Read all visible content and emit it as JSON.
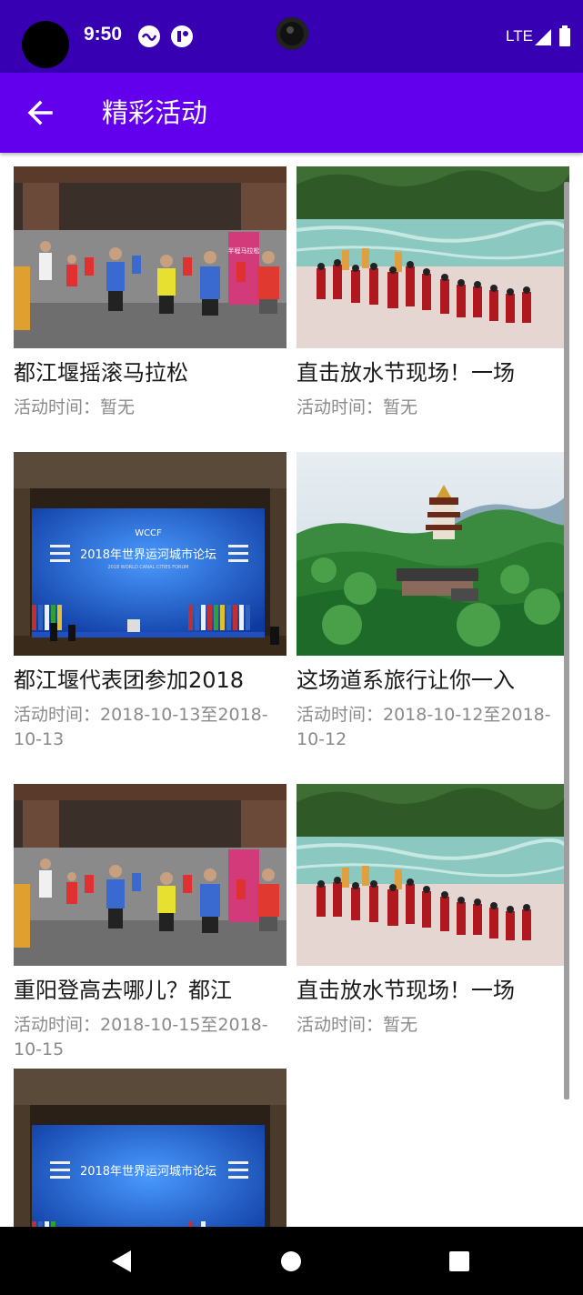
{
  "status_bar": {
    "time": "9:50",
    "network": "LTE",
    "icons": [
      "app-notification-icon",
      "record-notification-icon",
      "signal-icon",
      "battery-icon"
    ]
  },
  "app_bar": {
    "title": "精彩活动",
    "back_icon": "arrow-left-icon"
  },
  "activities": [
    {
      "title": "都江堰摇滚马拉松",
      "time": "活动时间：暂无",
      "image": "marathon-runners"
    },
    {
      "title": "直击放水节现场！一场",
      "time": "活动时间：暂无",
      "image": "river-ceremony"
    },
    {
      "title": "都江堰代表团参加2018",
      "time": "活动时间：2018-10-13至2018-10-13",
      "image": "forum-stage"
    },
    {
      "title": "这场道系旅行让你一入",
      "time": "活动时间：2018-10-12至2018-10-12",
      "image": "mountain-pagoda"
    },
    {
      "title": "重阳登高去哪儿？都江",
      "time": "活动时间：2018-10-15至2018-10-15",
      "image": "marathon-runners"
    },
    {
      "title": "直击放水节现场！一场",
      "time": "活动时间：暂无",
      "image": "river-ceremony"
    },
    {
      "title": "",
      "time": "",
      "image": "forum-stage"
    }
  ],
  "image_text": {
    "forum_banner": "2018年世界运河城市论坛",
    "forum_banner_en": "2018 WORLD CANAL CITIES FORUM",
    "forum_logo": "WCCF",
    "marathon_sign": "半程马拉松"
  },
  "nav_bar": {
    "buttons": [
      "back-triangle-icon",
      "home-circle-icon",
      "recents-square-icon"
    ]
  },
  "colors": {
    "status_bar": "#3700b3",
    "app_bar": "#6200ee",
    "title_text": "#1a1a1a",
    "meta_text": "#8a8a8a"
  }
}
